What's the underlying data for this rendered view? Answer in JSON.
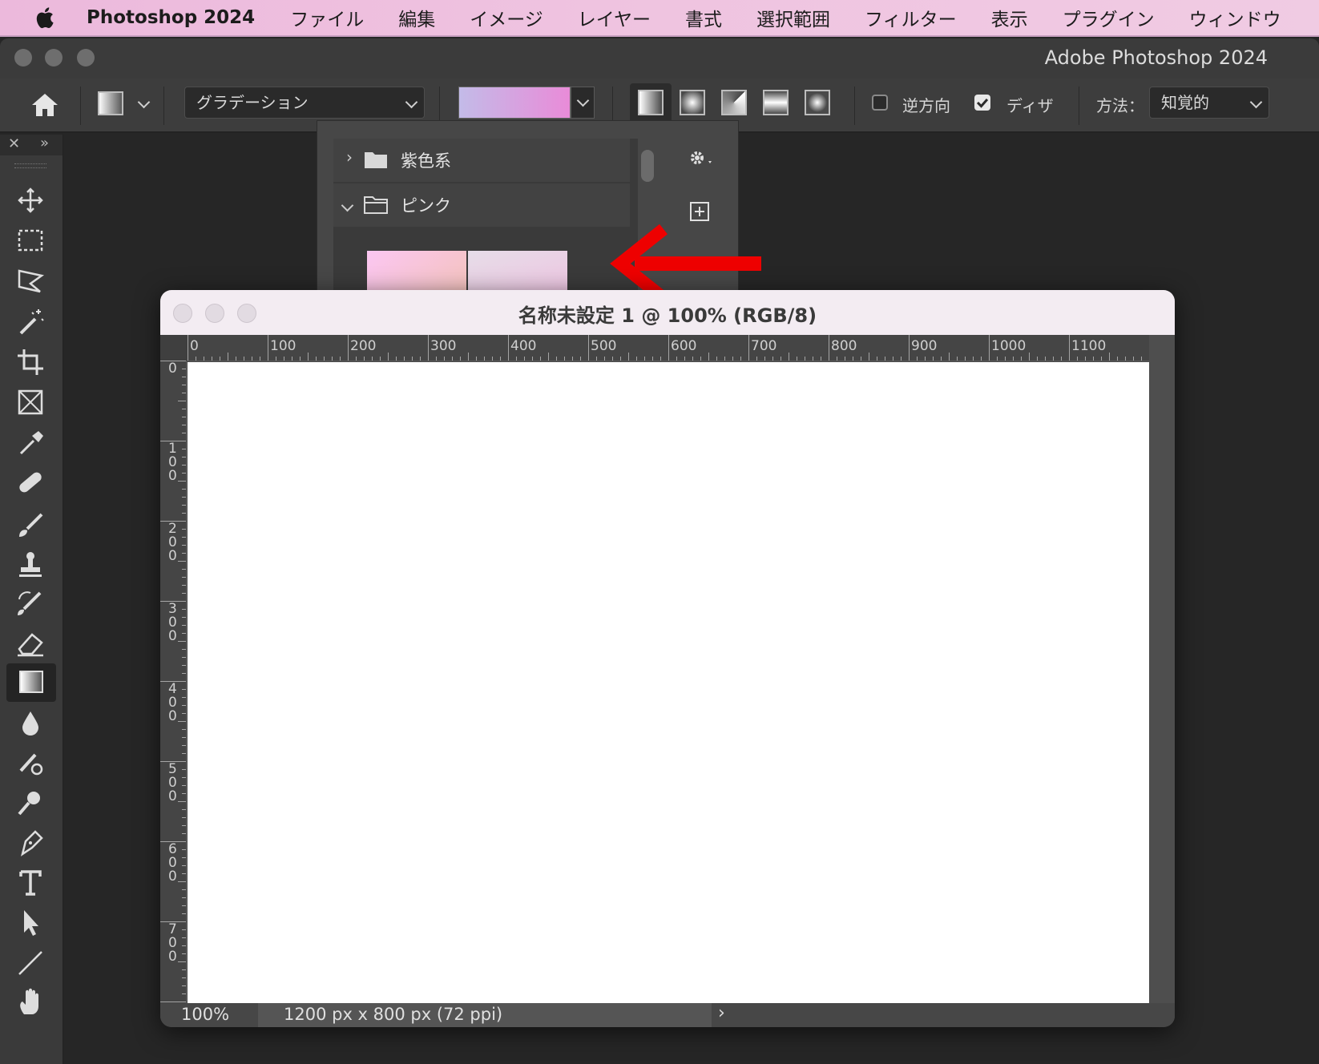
{
  "menubar": {
    "app_name": "Photoshop 2024",
    "items": [
      "ファイル",
      "編集",
      "イメージ",
      "レイヤー",
      "書式",
      "選択範囲",
      "フィルター",
      "表示",
      "プラグイン",
      "ウィンドウ"
    ]
  },
  "window": {
    "title": "Adobe Photoshop 2024"
  },
  "options_bar": {
    "tool_preset": "グラデーション",
    "gradient_colors": [
      "#c3bbe8",
      "#e98bd8"
    ],
    "reverse_label": "逆方向",
    "reverse_checked": false,
    "dither_label": "ディザ",
    "dither_checked": true,
    "method_label": "方法：",
    "method_value": "知覚的",
    "gradient_types": [
      "linear",
      "radial",
      "angle",
      "reflected",
      "diamond"
    ]
  },
  "gradient_picker": {
    "folders": [
      {
        "name": "紫色系",
        "expanded": false
      },
      {
        "name": "ピンク",
        "expanded": true
      }
    ],
    "swatches": [
      {
        "from": "#fbc6f2",
        "to": "#f3c3b6"
      },
      {
        "from": "#e6dde8",
        "to": "#f0bfe0"
      }
    ],
    "annotation_color": "#ee0000"
  },
  "document": {
    "title": "名称未設定 1 @ 100% (RGB/8)",
    "h_ruler": [
      "0",
      "100",
      "200",
      "300",
      "400",
      "500",
      "600",
      "700",
      "800",
      "900",
      "1000",
      "1100"
    ],
    "v_ruler": [
      "0",
      "1\n0\n0",
      "2\n0\n0",
      "3\n0\n0",
      "4\n0\n0",
      "5\n0\n0",
      "6\n0\n0",
      "7\n0\n0"
    ],
    "zoom": "100%",
    "doc_info": "1200 px x 800 px (72 ppi)"
  },
  "toolbar": {
    "tools": [
      "move-tool",
      "marquee-tool",
      "lasso-tool",
      "magic-wand-tool",
      "crop-tool",
      "frame-tool",
      "eyedropper-tool",
      "healing-brush-tool",
      "brush-tool",
      "clone-stamp-tool",
      "history-brush-tool",
      "eraser-tool",
      "gradient-tool",
      "blur-tool",
      "dodge-tool",
      "burn-tool",
      "pen-tool",
      "type-tool",
      "path-selection-tool",
      "line-tool",
      "hand-tool"
    ],
    "active": "gradient-tool"
  }
}
